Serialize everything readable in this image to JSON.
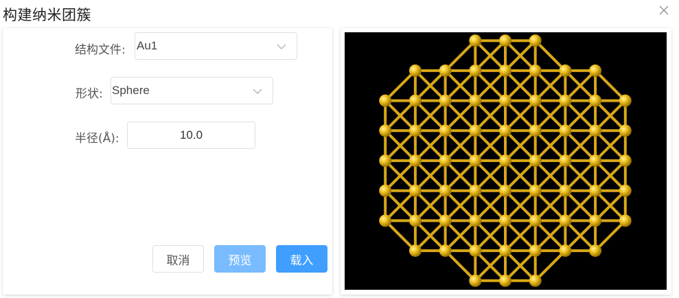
{
  "dialog": {
    "title": "构建纳米团簇"
  },
  "form": {
    "structure_file": {
      "label": "结构文件:",
      "value": "Au1"
    },
    "shape": {
      "label": "形状:",
      "value": "Sphere"
    },
    "radius": {
      "label": "半径(Å):",
      "value": "10.0"
    }
  },
  "buttons": {
    "cancel": "取消",
    "preview": "预览",
    "load": "载入"
  },
  "viewer": {
    "background": "#000000",
    "atom_color": "#f0c020",
    "bond_color": "#d9a818"
  },
  "colors": {
    "primary": "#409eff",
    "primary_light": "#79bbff",
    "border": "#dcdfe6"
  }
}
